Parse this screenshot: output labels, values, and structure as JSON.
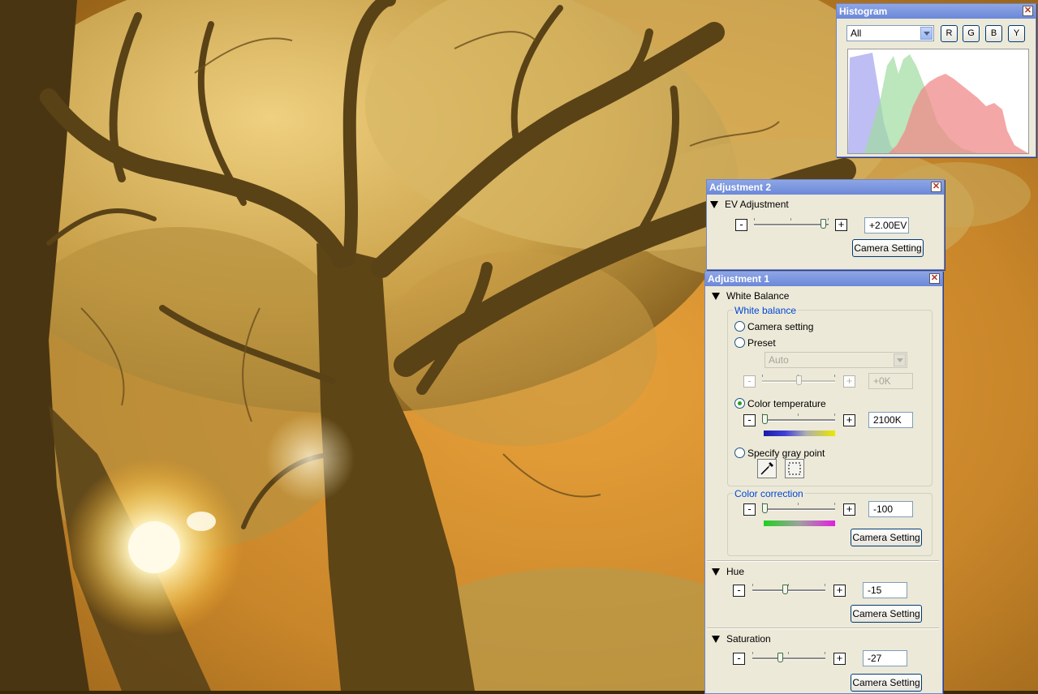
{
  "histogram": {
    "title": "Histogram",
    "channel_select": "All",
    "channel_buttons": [
      "R",
      "G",
      "B",
      "Y"
    ]
  },
  "adjustment2": {
    "title": "Adjustment 2",
    "ev": {
      "label": "EV Adjustment",
      "minus": "-",
      "plus": "+",
      "value": "+2.00EV",
      "slider_fraction": 0.97,
      "camera_setting": "Camera Setting"
    }
  },
  "adjustment1": {
    "title": "Adjustment 1",
    "white_balance": {
      "label": "White Balance",
      "group_title": "White balance",
      "options": {
        "camera_setting": "Camera setting",
        "preset": "Preset",
        "color_temperature": "Color temperature",
        "gray_point": "Specify gray point"
      },
      "selected": "color_temperature",
      "preset_select": "Auto",
      "preset_value": "+0K",
      "preset_slider_fraction": 0.5,
      "temperature_value": "2100K",
      "temperature_slider_fraction": 0.0,
      "minus": "-",
      "plus": "+"
    },
    "color_correction": {
      "group_title": "Color correction",
      "value": "-100",
      "slider_fraction": 0.0,
      "minus": "-",
      "plus": "+",
      "camera_setting": "Camera Setting"
    },
    "hue": {
      "label": "Hue",
      "value": "-15",
      "slider_fraction": 0.45,
      "minus": "-",
      "plus": "+",
      "camera_setting": "Camera Setting"
    },
    "saturation": {
      "label": "Saturation",
      "value": "-27",
      "slider_fraction": 0.37,
      "minus": "-",
      "plus": "+",
      "camera_setting": "Camera Setting"
    }
  },
  "colors": {
    "titlebar": "#7b95dd",
    "panel": "#ece9d8",
    "group_title": "#0046d5",
    "hist_red": "#f08a8a",
    "hist_green": "#9fdc9f",
    "hist_blue": "#a8a8f0"
  },
  "icons": {
    "close": "close-icon",
    "eyedropper": "eyedropper-icon",
    "marquee": "marquee-select-icon",
    "collapse": "triangle-down-icon"
  }
}
